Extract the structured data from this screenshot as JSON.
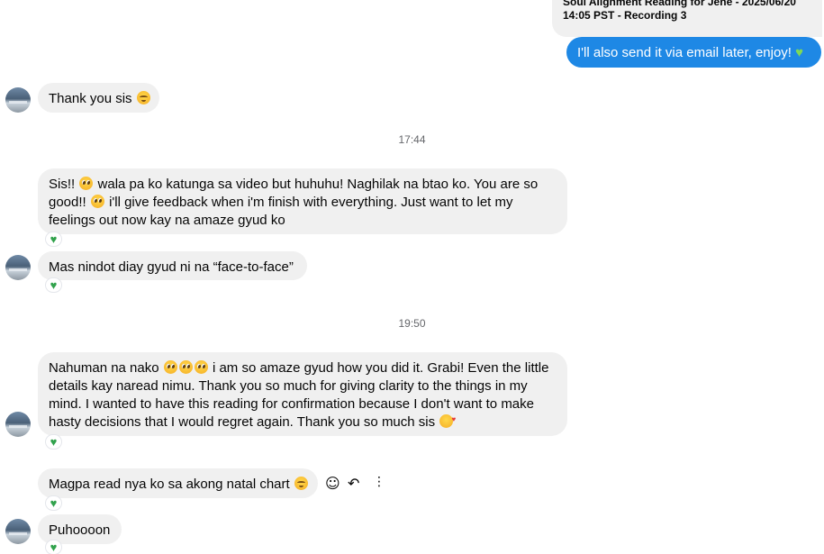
{
  "top_card": {
    "line1": "Soul Alignment Reading for Jene - 2025/06/20",
    "line2": "14:05 PST - Recording 3"
  },
  "messages": {
    "m1": "I'll also send it via email later, enjoy!",
    "m2": "Thank you sis",
    "ts1": "17:44",
    "m3_a": "Sis!!",
    "m3_b": "wala pa ko katunga sa video but huhuhu! Naghilak na btao ko. You are so",
    "m3_c": "good!!",
    "m3_d": "i'll give feedback when i'm finish with everything. Just want to let my",
    "m3_e": "feelings out now kay na amaze gyud ko",
    "m4": "Mas nindot diay gyud ni na “face-to-face”",
    "ts2": "19:50",
    "m5_a": "Nahuman na nako",
    "m5_b": "i am so amaze gyud how you did it. Grabi! Even the little",
    "m5_c": "details kay naread nimu. Thank you so much for giving clarity to the things in my",
    "m5_d": "mind. I wanted to have this reading for confirmation because I don't want to make",
    "m5_e": "hasty decisions that I would regret again. Thank you so much sis",
    "m6": "Magpa read nya ko sa akong natal chart",
    "m7": "Puhoooon"
  },
  "reaction_glyph": "♥",
  "icons": {
    "react": "smiley-face-icon",
    "reply": "reply-arrow-icon",
    "more": "more-vertical-icon"
  },
  "colors": {
    "outgoing_bubble": "#1e88e5",
    "incoming_bubble": "#f0f0f0",
    "reaction_heart": "#31a24c"
  }
}
